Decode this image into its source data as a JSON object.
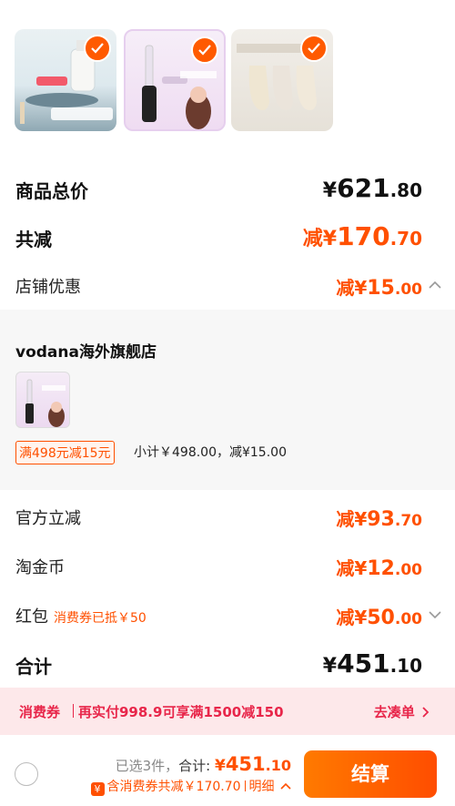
{
  "products": [
    {
      "name": "product-skincare",
      "checked": true,
      "badge_text": "到手价"
    },
    {
      "name": "product-curling-iron",
      "checked": true,
      "brand": "VODANA",
      "caption": "女神同款",
      "sub": "自然水波纹"
    },
    {
      "name": "product-socks",
      "checked": true,
      "caption": "SKIN FRIENDLY"
    }
  ],
  "summary": {
    "total_label": "商品总价",
    "total_currency": "¥",
    "total_int": "621",
    "total_dec": ".80",
    "reduce_label": "共减",
    "reduce_prefix": "减",
    "reduce_currency": "¥",
    "reduce_int": "170",
    "reduce_dec": ".70",
    "store_label": "店铺优惠",
    "store_prefix": "减",
    "store_currency": "¥",
    "store_int": "15",
    "store_dec": ".00"
  },
  "store": {
    "name": "vodana海外旗舰店",
    "promo_tag": "满498元减15元",
    "promo_text": "小计￥498.00，减¥15.00"
  },
  "discounts": [
    {
      "label": "官方立减",
      "prefix": "减",
      "currency": "¥",
      "int": "93",
      "dec": ".70"
    },
    {
      "label": "淘金币",
      "prefix": "减",
      "currency": "¥",
      "int": "12",
      "dec": ".00"
    },
    {
      "label": "红包",
      "hint": "消费券已抵￥50",
      "prefix": "减",
      "currency": "¥",
      "int": "50",
      "dec": ".00"
    }
  ],
  "total": {
    "label": "合计",
    "currency": "¥",
    "int": "451",
    "dec": ".10"
  },
  "banner": {
    "label": "消费券",
    "text": "再实付998.9可享满1500减150",
    "link": "去凑单"
  },
  "bottom": {
    "selected": "已选3件，",
    "total_label": "合计:",
    "currency": "¥",
    "int": "451",
    "dec": ".10",
    "coin_icon": "¥",
    "detail": "含消费券共减￥170.70",
    "detail_link": "明细",
    "checkout": "结算"
  },
  "colors": {
    "accent": "#ff5000",
    "banner_text": "#e8264a",
    "banner_bg": "#fde8ea"
  }
}
